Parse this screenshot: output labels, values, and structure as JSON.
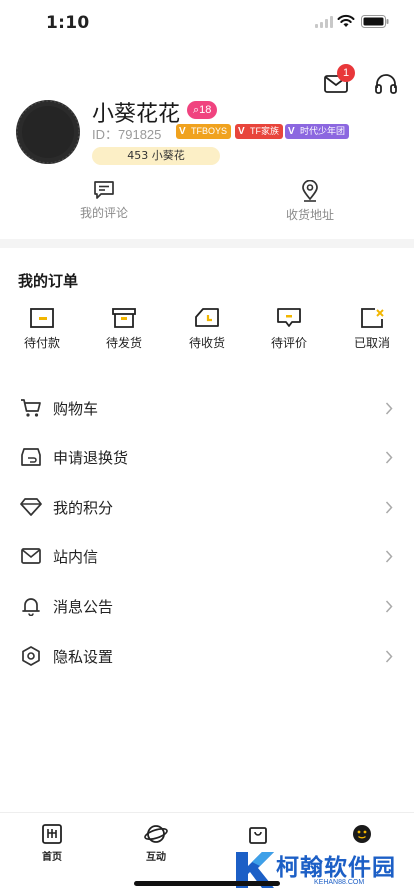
{
  "status_bar": {
    "time": "1:10"
  },
  "header": {
    "notification_count": "1",
    "mail_icon": "mail-icon",
    "service_icon": "headset-icon"
  },
  "profile": {
    "username": "小葵花花",
    "level": "18",
    "id_label": "ID：791825",
    "tags": [
      "TFBOYS",
      "TF家族",
      "时代少年团"
    ],
    "points": "453 小葵花"
  },
  "quick_links": [
    {
      "label": "我的评论",
      "icon": "comment-icon"
    },
    {
      "label": "收货地址",
      "icon": "location-icon"
    }
  ],
  "orders": {
    "title": "我的订单",
    "items": [
      {
        "label": "待付款",
        "icon": "wallet-icon"
      },
      {
        "label": "待发货",
        "icon": "box-icon"
      },
      {
        "label": "待收货",
        "icon": "truck-icon"
      },
      {
        "label": "待评价",
        "icon": "review-icon"
      },
      {
        "label": "已取消",
        "icon": "cancelled-icon"
      }
    ]
  },
  "menu": [
    {
      "label": "购物车",
      "icon": "cart-icon"
    },
    {
      "label": "申请退换货",
      "icon": "return-icon"
    },
    {
      "label": "我的积分",
      "icon": "diamond-icon"
    },
    {
      "label": "站内信",
      "icon": "envelope-icon"
    },
    {
      "label": "消息公告",
      "icon": "bell-icon"
    },
    {
      "label": "隐私设置",
      "icon": "settings-icon"
    }
  ],
  "tabbar": [
    {
      "label": "首页",
      "icon": "home-icon"
    },
    {
      "label": "互动",
      "icon": "planet-icon"
    },
    {
      "label": "",
      "icon": "bag-icon"
    },
    {
      "label": "",
      "icon": "me-icon"
    }
  ],
  "watermark": {
    "name": "柯翰软件园",
    "url": "KEHAN88.COM"
  },
  "colors": {
    "accent_red": "#e8373a",
    "level_pink": "#f0437f",
    "points_bg": "#fcefc6",
    "order_yellow": "#f2b600",
    "watermark_blue": "#1c5fc6"
  }
}
